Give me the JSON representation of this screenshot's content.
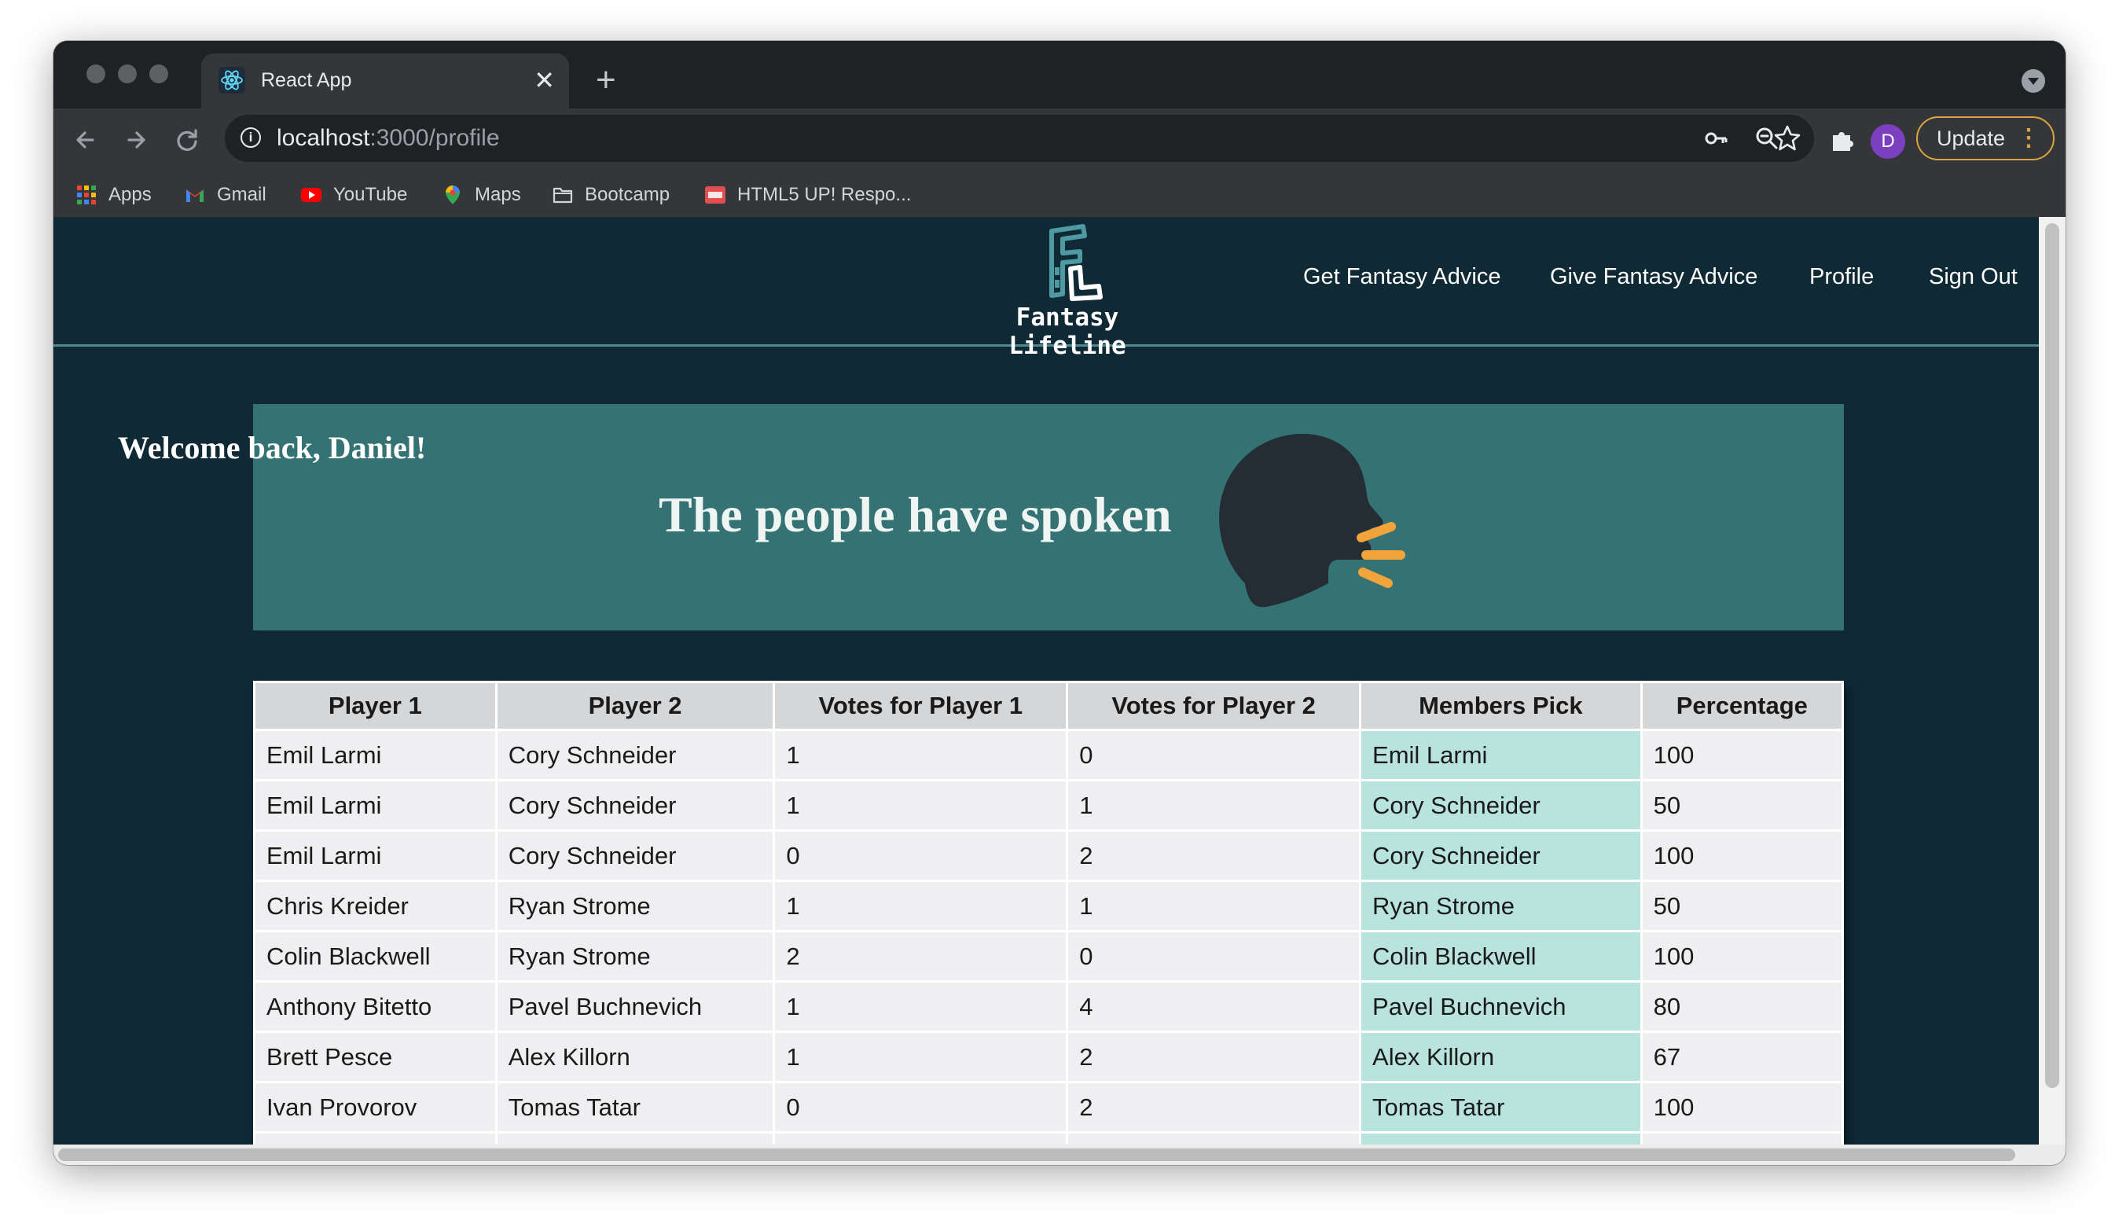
{
  "browser": {
    "tab_title": "React App",
    "tab_close": "✕",
    "new_tab": "+",
    "url_host": "localhost",
    "url_path": ":3000/profile",
    "avatar_letter": "D",
    "update_label": "Update",
    "bookmarks": [
      {
        "label": "Apps",
        "icon": "apps-grid-icon"
      },
      {
        "label": "Gmail",
        "icon": "gmail-icon"
      },
      {
        "label": "YouTube",
        "icon": "youtube-icon"
      },
      {
        "label": "Maps",
        "icon": "maps-pin-icon"
      },
      {
        "label": "Bootcamp",
        "icon": "folder-icon"
      },
      {
        "label": "HTML5 UP! Respo...",
        "icon": "html5up-icon"
      }
    ]
  },
  "site": {
    "logo_text": "Fantasy Lifeline",
    "nav": [
      "Get Fantasy Advice",
      "Give Fantasy Advice",
      "Profile",
      "Sign Out"
    ],
    "welcome": "Welcome back, Daniel!",
    "banner_title": "The people have spoken"
  },
  "colors": {
    "page_bg": "#0f2935",
    "banner_bg": "#347274",
    "members_pick_bg": "#b9e4dd",
    "accent_orange": "#f2a33a"
  },
  "table": {
    "headers": [
      "Player 1",
      "Player 2",
      "Votes for Player 1",
      "Votes for Player 2",
      "Members Pick",
      "Percentage"
    ],
    "rows": [
      [
        "Emil Larmi",
        "Cory Schneider",
        "1",
        "0",
        "Emil Larmi",
        "100"
      ],
      [
        "Emil Larmi",
        "Cory Schneider",
        "1",
        "1",
        "Cory Schneider",
        "50"
      ],
      [
        "Emil Larmi",
        "Cory Schneider",
        "0",
        "2",
        "Cory Schneider",
        "100"
      ],
      [
        "Chris Kreider",
        "Ryan Strome",
        "1",
        "1",
        "Ryan Strome",
        "50"
      ],
      [
        "Colin Blackwell",
        "Ryan Strome",
        "2",
        "0",
        "Colin Blackwell",
        "100"
      ],
      [
        "Anthony Bitetto",
        "Pavel Buchnevich",
        "1",
        "4",
        "Pavel Buchnevich",
        "80"
      ],
      [
        "Brett Pesce",
        "Alex Killorn",
        "1",
        "2",
        "Alex Killorn",
        "67"
      ],
      [
        "Ivan Provorov",
        "Tomas Tatar",
        "0",
        "2",
        "Tomas Tatar",
        "100"
      ],
      [
        "",
        "",
        "",
        "",
        "",
        ""
      ]
    ]
  }
}
